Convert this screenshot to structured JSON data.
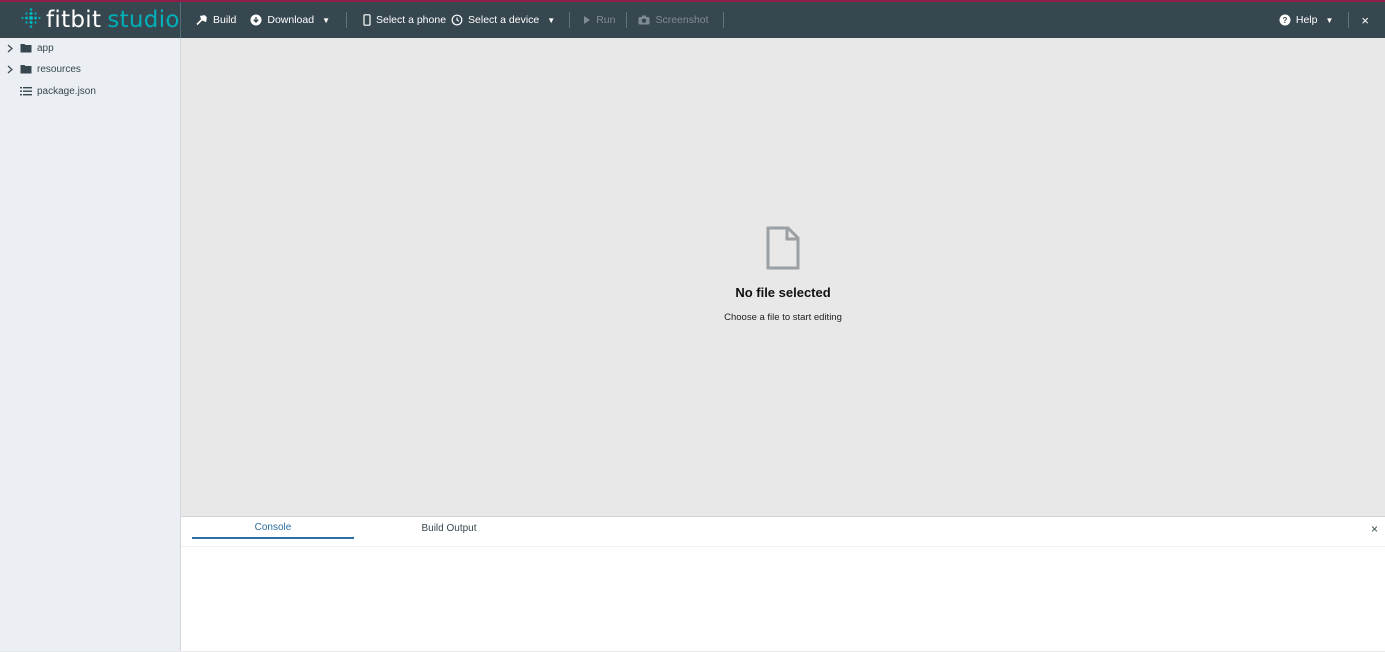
{
  "brand": {
    "name_a": "fitbit",
    "name_b": "studio",
    "accent": "#00b0b9"
  },
  "toolbar": {
    "build": "Build",
    "download": "Download",
    "phone": "Select a phone",
    "device": "Select a device",
    "run": "Run",
    "screenshot": "Screenshot",
    "help": "Help",
    "close": "×"
  },
  "sidebar": {
    "items": [
      {
        "label": "app",
        "icon": "folder-icon",
        "expandable": true
      },
      {
        "label": "resources",
        "icon": "folder-icon",
        "expandable": true
      },
      {
        "label": "package.json",
        "icon": "list-icon",
        "expandable": false
      }
    ]
  },
  "editor": {
    "empty_title": "No file selected",
    "empty_subtitle": "Choose a file to start editing",
    "icon": "file-icon"
  },
  "bottom_panel": {
    "tabs": [
      {
        "label": "Console",
        "active": true
      },
      {
        "label": "Build Output",
        "active": false
      }
    ],
    "close": "×"
  },
  "colors": {
    "topbar": "#37474f",
    "topbar_border": "#8e1f4a",
    "sidebar": "#ebeff3",
    "editor_bg": "#e8e8e8",
    "active_tab": "#2b6ea0"
  }
}
